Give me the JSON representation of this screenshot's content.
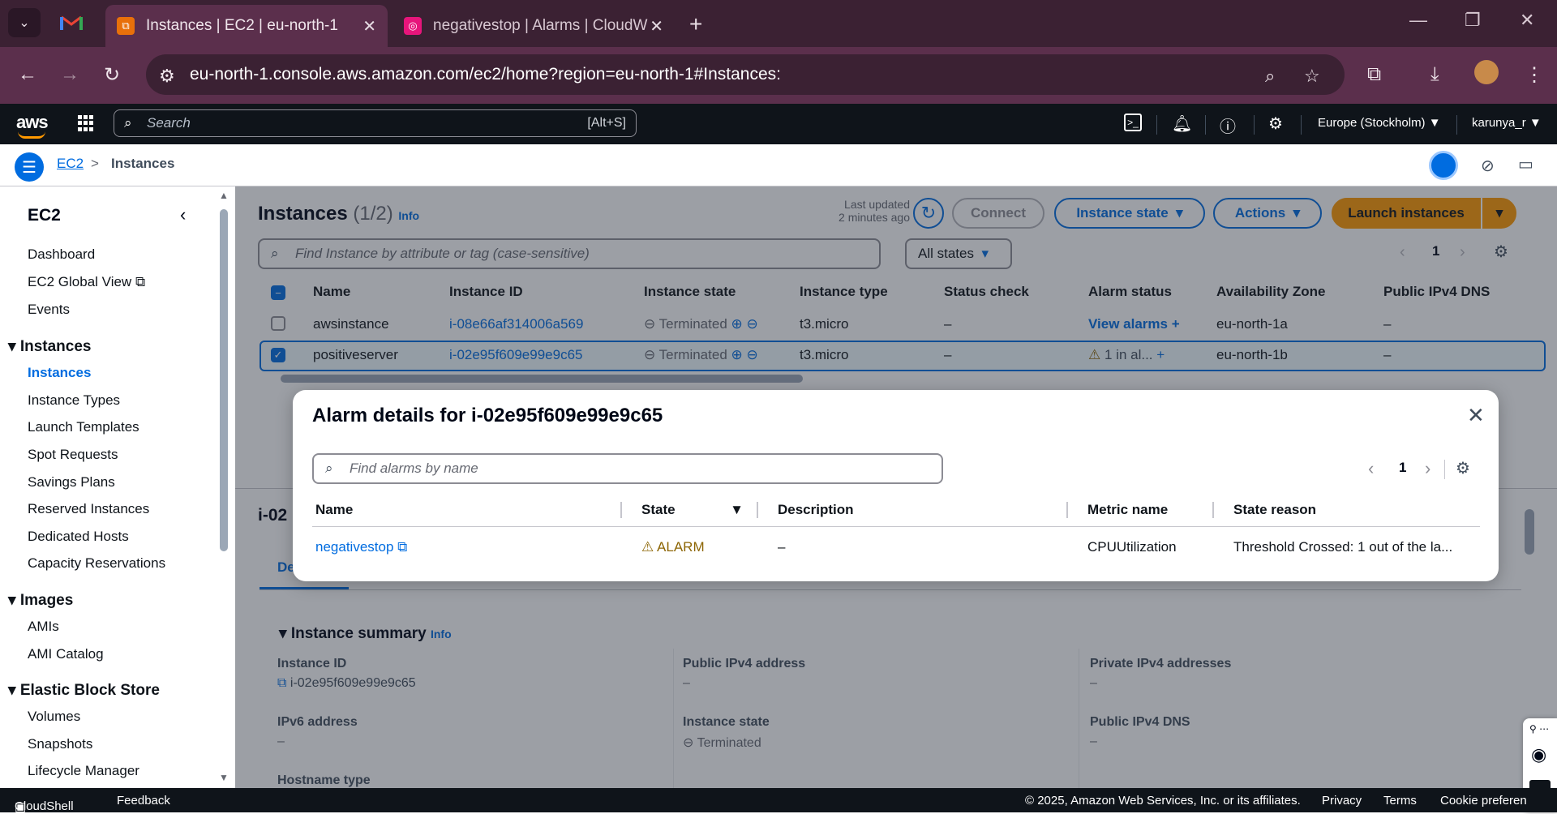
{
  "browser": {
    "tabs": [
      {
        "label": "Instances | EC2 | eu-north-1",
        "active": true
      },
      {
        "label": "negativestop | Alarms | CloudW",
        "active": false
      }
    ],
    "url": "eu-north-1.console.aws.amazon.com/ec2/home?region=eu-north-1#Instances:"
  },
  "aws_header": {
    "logo": "aws",
    "search_placeholder": "Search",
    "search_shortcut": "[Alt+S]",
    "region": "Europe (Stockholm) ▼",
    "user": "karunya_r ▼"
  },
  "breadcrumb": {
    "root": "EC2",
    "sep": ">",
    "current": "Instances"
  },
  "sidebar": {
    "title": "EC2",
    "top_items": [
      "Dashboard",
      "EC2 Global View",
      "Events"
    ],
    "sections": [
      {
        "title": "Instances",
        "items": [
          "Instances",
          "Instance Types",
          "Launch Templates",
          "Spot Requests",
          "Savings Plans",
          "Reserved Instances",
          "Dedicated Hosts",
          "Capacity Reservations"
        ]
      },
      {
        "title": "Images",
        "items": [
          "AMIs",
          "AMI Catalog"
        ]
      },
      {
        "title": "Elastic Block Store",
        "items": [
          "Volumes",
          "Snapshots",
          "Lifecycle Manager"
        ]
      }
    ]
  },
  "instances_panel": {
    "title": "Instances",
    "count": "(1/2)",
    "info": "Info",
    "last_updated_1": "Last updated",
    "last_updated_2": "2 minutes ago",
    "connect": "Connect",
    "instance_state": "Instance state",
    "actions": "Actions",
    "launch": "Launch instances",
    "filter_placeholder": "Find Instance by attribute or tag (case-sensitive)",
    "states_filter": "All states",
    "page": "1",
    "columns": [
      "Name",
      "Instance ID",
      "Instance state",
      "Instance type",
      "Status check",
      "Alarm status",
      "Availability Zone",
      "Public IPv4 DNS"
    ],
    "rows": [
      {
        "name": "awsinstance",
        "id": "i-08e66af314006a569",
        "state": "Terminated",
        "type": "t3.micro",
        "status": "–",
        "alarm": "View alarms",
        "zone": "eu-north-1a",
        "dns": "–",
        "selected": false
      },
      {
        "name": "positiveserver",
        "id": "i-02e95f609e99e9c65",
        "state": "Terminated",
        "type": "t3.micro",
        "status": "–",
        "alarm": "1 in al...",
        "zone": "eu-north-1b",
        "dns": "–",
        "selected": true
      }
    ]
  },
  "details": {
    "heading_prefix": "i-02",
    "tab_prefix": "De",
    "summary_title": "Instance summary",
    "summary_info": "Info",
    "fields": [
      {
        "label": "Instance ID",
        "value": "i-02e95f609e99e9c65"
      },
      {
        "label": "Public IPv4 address",
        "value": "–"
      },
      {
        "label": "Private IPv4 addresses",
        "value": "–"
      },
      {
        "label": "IPv6 address",
        "value": "–"
      },
      {
        "label": "Instance state",
        "value": "Terminated"
      },
      {
        "label": "Public IPv4 DNS",
        "value": "–"
      },
      {
        "label": "Hostname type",
        "value": ""
      }
    ]
  },
  "modal": {
    "title": "Alarm details for i-02e95f609e99e9c65",
    "search_placeholder": "Find alarms by name",
    "page": "1",
    "columns": [
      "Name",
      "State",
      "Description",
      "Metric name",
      "State reason"
    ],
    "row": {
      "name": "negativestop",
      "state": "ALARM",
      "description": "–",
      "metric": "CPUUtilization",
      "reason": "Threshold Crossed: 1 out of the la..."
    }
  },
  "footer": {
    "cloudshell": "CloudShell",
    "feedback": "Feedback",
    "copyright": "© 2025, Amazon Web Services, Inc. or its affiliates.",
    "privacy": "Privacy",
    "terms": "Terms",
    "cookie": "Cookie preferen"
  },
  "colors": {
    "accent": "#006ce0",
    "primary": "#ff9900",
    "alarm": "#8d6605",
    "header": "#0f141a"
  }
}
